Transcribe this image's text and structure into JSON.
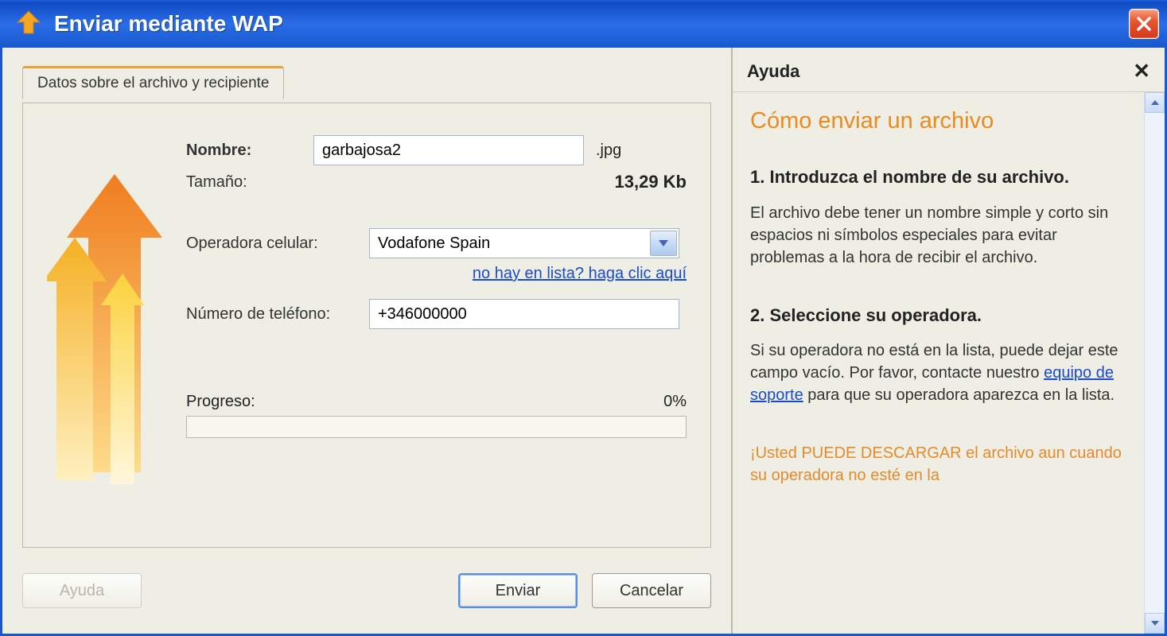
{
  "window": {
    "title": "Enviar mediante WAP"
  },
  "tab": {
    "label": "Datos sobre el archivo y recipiente"
  },
  "form": {
    "name_label": "Nombre:",
    "name_value": "garbajosa2",
    "ext": ".jpg",
    "size_label": "Tamaño:",
    "size_value": "13,29 Kb",
    "operator_label": "Operadora celular:",
    "operator_value": "Vodafone Spain",
    "notlisted_link": "no hay en lista? haga clic aquí",
    "phone_label": "Número de teléfono:",
    "phone_value": "+346000000",
    "progress_label": "Progreso:",
    "progress_value": "0%"
  },
  "buttons": {
    "help": "Ayuda",
    "send": "Enviar",
    "cancel": "Cancelar"
  },
  "help": {
    "title": "Ayuda",
    "heading": "Cómo enviar un archivo",
    "step1_title": "1. Introduzca el nombre de su archivo.",
    "step1_body": "El archivo debe tener un nombre simple y corto sin espacios ni símbolos especiales para evitar problemas a la hora de recibir el archivo.",
    "step2_title": "2. Seleccione su operadora.",
    "step2_body_a": "Si su operadora no está en la lista, puede dejar este campo vacío. Por favor, contacte nuestro ",
    "step2_link": "equipo de soporte",
    "step2_body_b": " para que su operadora aparezca en la lista.",
    "note": "¡Usted PUEDE DESCARGAR el archivo aun cuando su operadora no esté en la"
  }
}
